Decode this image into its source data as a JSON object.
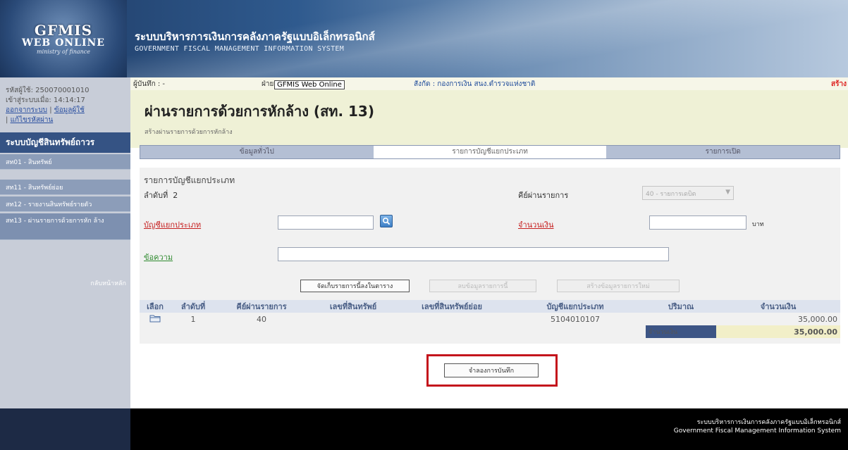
{
  "header": {
    "logo_main": "GFMIS",
    "logo_sub": "WEB ONLINE",
    "logo_ministry": "ministry of finance",
    "title_th": "ระบบบริหารการเงินการคลังภาครัฐแบบอิเล็กทรอนิกส์",
    "title_en": "GOVERNMENT FISCAL MANAGEMENT INFORMATION SYSTEM"
  },
  "sidebar": {
    "user_label": "รหัสผู้ใช้: 250070001010",
    "login_time": "เข้าสู่ระบบเมื่อ: 14:14:17",
    "logout": "ออกจากระบบ",
    "user_data": "ข้อมูลผู้ใช้",
    "edit_password": "แก้ไขรหัสผ่าน",
    "menu_title": "ระบบบัญชีสินทรัพย์ถาวร",
    "items": [
      {
        "label": "สท01 - สินทรัพย์"
      },
      {
        "label": "สท11 - สินทรัพย์ย่อย"
      },
      {
        "label": "สท12 - รายงานสินทรัพย์รายตัว"
      },
      {
        "label": "สท13 - ผ่านรายการด้วยการหัก ล้าง"
      }
    ],
    "back": "กลับหน้าหลัก"
  },
  "topbar": {
    "recorder": "ผู้บันทึก : -",
    "dept": "ฝ่าย",
    "tooltip": "GFMIS Web Online",
    "affiliation": "สังกัด : กองการเงิน สนง.ตำรวจแห่งชาติ",
    "mode": "สร้าง"
  },
  "page": {
    "title": "ผ่านรายการด้วยการหักล้าง (สท. 13)",
    "subtitle": "สร้างผ่านรายการด้วยการหักล้าง"
  },
  "tabs": [
    {
      "label": "ข้อมูลทั่วไป"
    },
    {
      "label": "รายการบัญชีแยกประเภท"
    },
    {
      "label": "รายการเปิด"
    }
  ],
  "form": {
    "section_title": "รายการบัญชีแยกประเภท",
    "seq_label": "ลำดับที่",
    "seq_value": "2",
    "posting_key_label": "คีย์ผ่านรายการ",
    "posting_key_value": "40 - รายการเดบิต",
    "gl_label": "บัญชีแยกประเภท",
    "gl_value": "",
    "amount_label": "จำนวนเงิน",
    "amount_value": "",
    "currency": "บาท",
    "text_label": "ข้อความ",
    "text_value": "",
    "btn_store": "จัดเก็บรายการนี้ลงในตาราง",
    "btn_delete": "ลบข้อมูลรายการนี้",
    "btn_new": "สร้างข้อมูลรายการใหม่"
  },
  "table": {
    "headers": [
      "เลือก",
      "ลำดับที่",
      "คีย์ผ่านรายการ",
      "เลขที่สินทรัพย์",
      "เลขที่สินทรัพย์ย่อย",
      "บัญชีแยกประเภท",
      "ปริมาณ",
      "จำนวนเงิน"
    ],
    "rows": [
      {
        "seq": "1",
        "posting_key": "40",
        "asset": "",
        "sub_asset": "",
        "gl": "5104010107",
        "qty": "",
        "amount": "35,000.00"
      }
    ],
    "total_label": "จำนวนเงิน",
    "total_value": "35,000.00"
  },
  "save_button": "จำลองการบันทึก",
  "footer": {
    "th": "ระบบบริหารการเงินการคลังภาครัฐแบบอิเล็กทรอนิกส์",
    "en": "Government Fiscal Management Information System"
  }
}
